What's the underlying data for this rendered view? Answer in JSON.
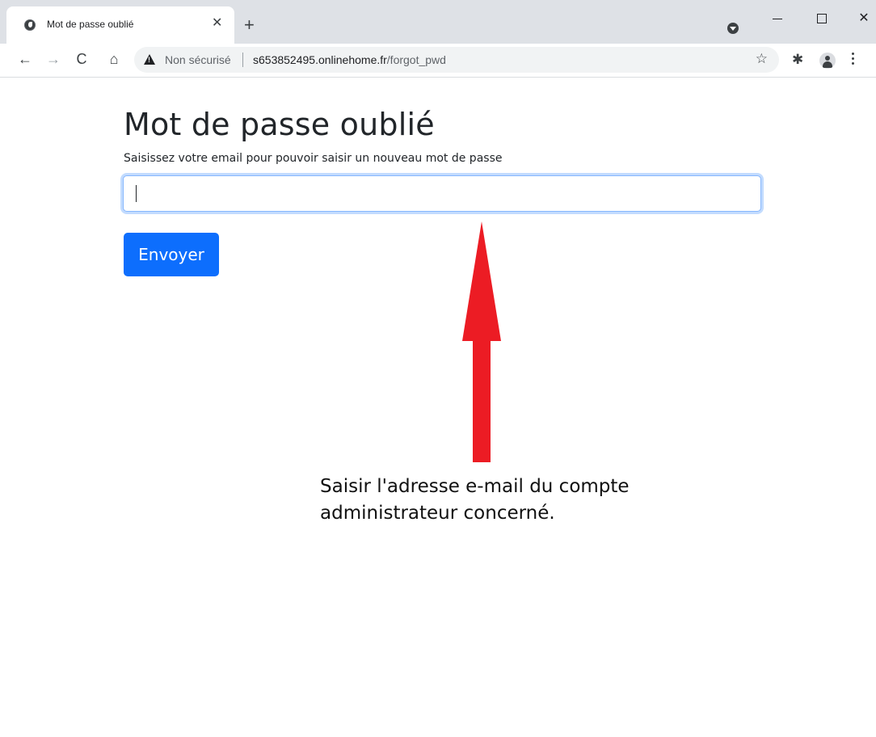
{
  "browser": {
    "tab": {
      "title": "Mot de passe oublié",
      "close_glyph": "✕"
    },
    "new_tab_glyph": "+",
    "window_controls": {
      "close_glyph": "✕"
    },
    "toolbar": {
      "back_glyph": "←",
      "forward_glyph": "→",
      "reload_glyph": "C",
      "home_glyph": "⌂",
      "security_label": "Non sécurisé",
      "url_host": "s653852495.onlinehome.fr",
      "url_path": "/forgot_pwd",
      "star_glyph": "☆",
      "extensions_glyph": "✱"
    }
  },
  "page": {
    "title": "Mot de passe oublié",
    "subtitle": "Saisissez votre email pour pouvoir saisir un nouveau mot de passe",
    "email_value": "",
    "submit_label": "Envoyer"
  },
  "annotation": {
    "line1": "Saisir l'adresse e-mail du compte",
    "line2": "administrateur concerné.",
    "arrow_color": "#ec1c24"
  },
  "colors": {
    "primary_button": "#0d6efd",
    "focus_border": "#86b7fe",
    "tabstrip_bg": "#dee1e6",
    "text": "#212529"
  }
}
